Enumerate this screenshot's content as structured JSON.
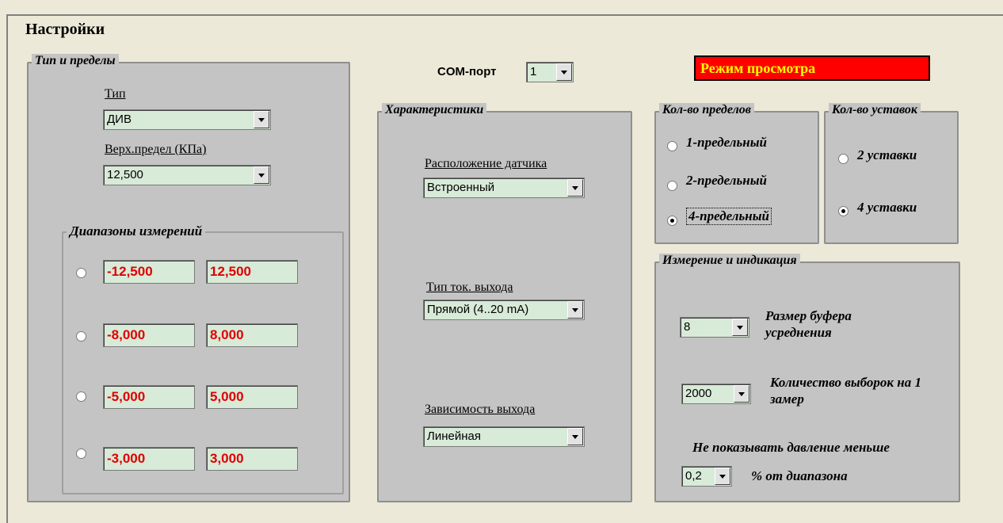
{
  "title": "Настройки",
  "com_port": {
    "label": "COM-порт",
    "value": "1"
  },
  "mode_badge": "Режим просмотра",
  "type_limits": {
    "legend": "Тип и пределы",
    "type_label": "Тип",
    "type_value": "ДИВ",
    "upper_label": "Верх.предел (КПа)",
    "upper_value": "12,500"
  },
  "ranges": {
    "legend": "Диапазоны измерений",
    "rows": [
      {
        "min": "-12,500",
        "max": "12,500"
      },
      {
        "min": "-8,000",
        "max": "8,000"
      },
      {
        "min": "-5,000",
        "max": "5,000"
      },
      {
        "min": "-3,000",
        "max": "3,000"
      }
    ]
  },
  "characteristics": {
    "legend": "Характеристики",
    "location_label": "Расположение датчика",
    "location_value": "Встроенный",
    "output_label": "Тип ток. выхода",
    "output_value": "Прямой (4..20 mA)",
    "dependency_label": "Зависимость выхода",
    "dependency_value": "Линейная"
  },
  "limits_count": {
    "legend": "Кол-во пределов",
    "options": [
      "1-предельный",
      "2-предельный",
      "4-предельный"
    ],
    "selected_index": 2
  },
  "setpoints_count": {
    "legend": "Кол-во уставок",
    "options": [
      "2 уставки",
      "4 уставки"
    ],
    "selected_index": 1
  },
  "measurement": {
    "legend": "Измерение и индикация",
    "buffer_value": "8",
    "buffer_label": "Размер буфера усреднения",
    "samples_value": "2000",
    "samples_label": "Количество выборок на 1 замер",
    "hide_label": "Не показывать давление меньше",
    "hide_value": "0,2",
    "hide_suffix": "% от диапазона"
  },
  "colors": {
    "accent_red": "#ff0000",
    "badge_text": "#ffff00",
    "field_bg": "#d8ead8",
    "range_text": "#e00000",
    "panel_bg": "#c4c4c4"
  }
}
